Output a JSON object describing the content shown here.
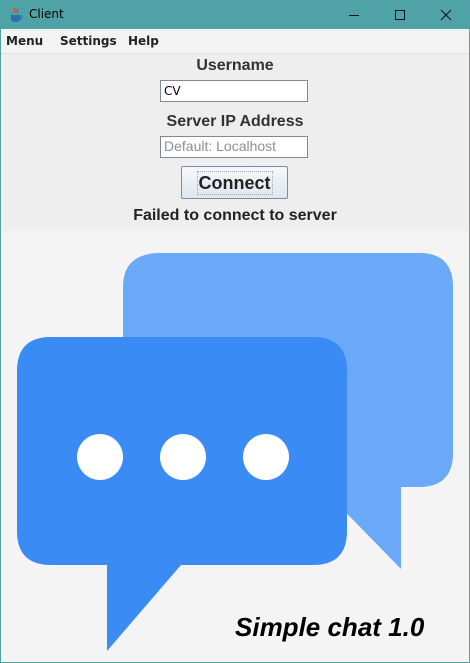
{
  "window": {
    "title": "Client",
    "icon": "java-cup-icon",
    "controls": [
      "minimize-icon",
      "maximize-icon",
      "close-icon"
    ]
  },
  "menubar": {
    "items": [
      "Menu",
      "Settings",
      "Help"
    ]
  },
  "form": {
    "username_label": "Username",
    "username_value": "CV",
    "server_label": "Server IP Address",
    "server_placeholder": "Default: Localhost",
    "connect_label": "Connect",
    "status_text": "Failed to connect to server"
  },
  "logo": {
    "icon": "chat-bubbles-icon",
    "tagline": "Simple chat 1.0",
    "colors": {
      "front_bubble": "#3b8bf4",
      "back_bubble": "#6aa8f8",
      "dots": "#ffffff"
    }
  },
  "colors": {
    "titlebar": "#4fa3a6",
    "panel": "#eeeeee"
  }
}
